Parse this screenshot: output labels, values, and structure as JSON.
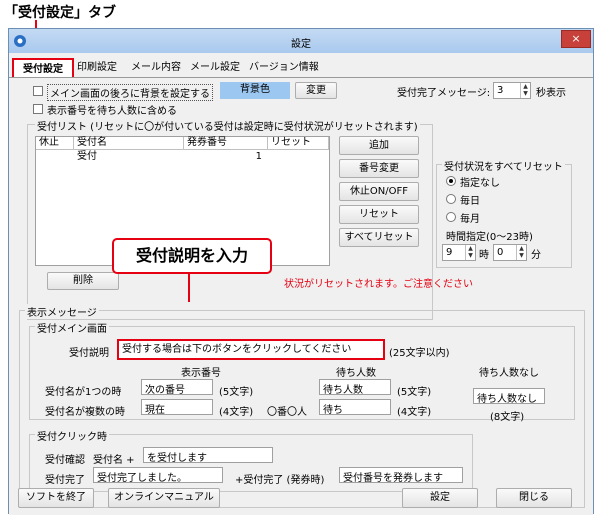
{
  "caption": "「受付設定」タブ",
  "window": {
    "title": "設定",
    "close": "×"
  },
  "tabs": [
    {
      "label": "受付設定",
      "active": true
    },
    {
      "label": "印刷設定"
    },
    {
      "label": "メール内容"
    },
    {
      "label": "メール設定"
    },
    {
      "label": "バージョン情報"
    }
  ],
  "top": {
    "bg_checkbox_label": "メイン画面の後ろに背景を設定する",
    "bg_color_label": "背景色",
    "change_button": "変更",
    "complete_msg_label": "受付完了メッセージ:",
    "complete_msg_value": "3",
    "seconds_label": "秒表示",
    "include_waiting_label": "表示番号を待ち人数に含める"
  },
  "list": {
    "group_title": "受付リスト (リセットに〇が付いている受付は設定時に受付状況がリセットされます)",
    "columns": [
      "休止",
      "受付名",
      "発券番号",
      "リセット"
    ],
    "rows": [
      {
        "pause": "",
        "name": "受付",
        "number": "1",
        "reset": ""
      }
    ],
    "buttons": [
      "追加",
      "番号変更",
      "休止ON/OFF",
      "リセット",
      "すべてリセット"
    ],
    "delete_button": "削除",
    "warning": "状況がリセットされます。ご注意ください"
  },
  "reset_all": {
    "group_title": "受付状況をすべてリセット",
    "options": [
      "指定なし",
      "毎日",
      "毎月"
    ],
    "selected": "指定なし",
    "time_label": "時間指定(0〜23時)",
    "hour_value": "9",
    "hour_unit": "時",
    "minute_value": "0",
    "minute_unit": "分"
  },
  "callout": {
    "text": "受付説明を入力"
  },
  "display_msg": {
    "group_title": "表示メッセージ",
    "main_screen": {
      "group_title": "受付メイン画面",
      "desc_label": "受付説明",
      "desc_value": "受付する場合は下のボタンをクリックしてください",
      "desc_limit": "(25文字以内)",
      "col_display_number": "表示番号",
      "col_waiting": "待ち人数",
      "col_no_waiting": "待ち人数なし",
      "single_label": "受付名が1つの時",
      "single_number": "次の番号",
      "single_number_limit": "(5文字)",
      "single_waiting": "待ち人数",
      "single_waiting_limit": "(5文字)",
      "multi_label": "受付名が複数の時",
      "multi_number": "現在",
      "multi_number_limit": "(4文字)",
      "multi_mid": "〇番〇人",
      "multi_waiting": "待ち",
      "multi_waiting_limit": "(4文字)",
      "no_waiting_value": "待ち人数なし",
      "no_waiting_limit": "(8文字)"
    },
    "click": {
      "group_title": "受付クリック時",
      "confirm_label": "受付確認",
      "confirm_prefix": "受付名 +",
      "confirm_value": "を受付します",
      "complete_label": "受付完了",
      "complete_value": "受付完了しました。",
      "complete_ticket_label": "+受付完了 (発券時)",
      "complete_ticket_value": "受付番号を発券します"
    }
  },
  "footer": {
    "quit": "ソフトを終了",
    "manual": "オンラインマニュアル",
    "settings": "設定",
    "close": "閉じる"
  },
  "colors": {
    "accent_red": "#e50012",
    "bg_swatch": "#9cc7f0"
  }
}
